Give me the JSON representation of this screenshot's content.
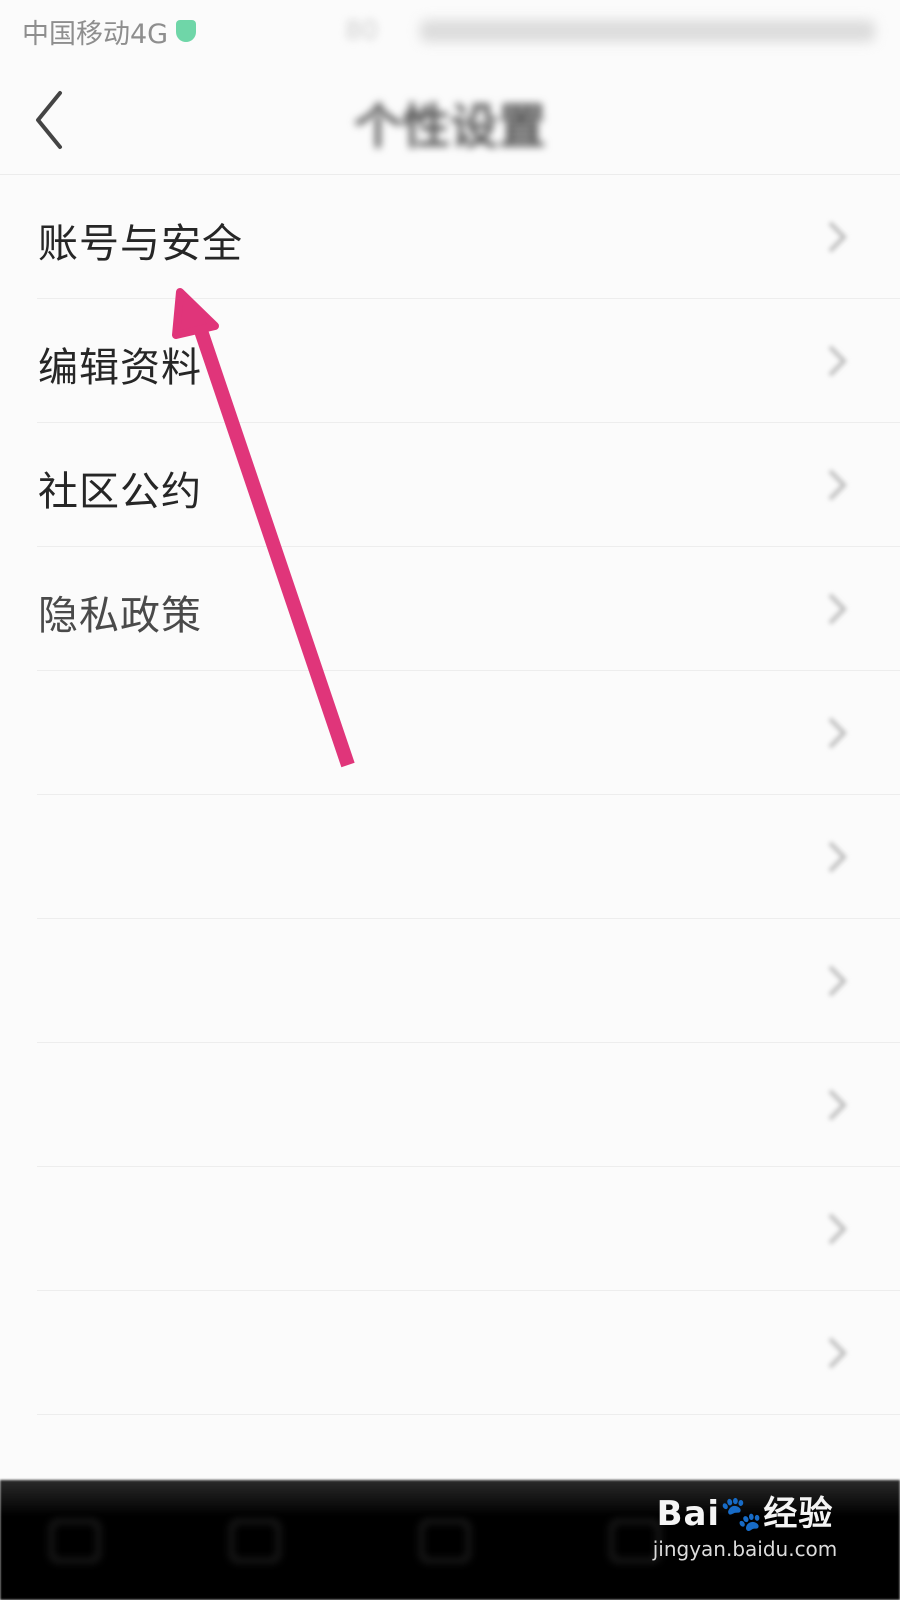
{
  "status_bar": {
    "carrier": "中国移动4G",
    "right_text": "80"
  },
  "header": {
    "title": "个性设置"
  },
  "menu": {
    "items": [
      {
        "label": "账号与安全"
      },
      {
        "label": "编辑资料"
      },
      {
        "label": "社区公约"
      },
      {
        "label": "隐私政策"
      },
      {
        "label": ""
      },
      {
        "label": ""
      },
      {
        "label": ""
      },
      {
        "label": ""
      },
      {
        "label": ""
      },
      {
        "label": ""
      }
    ]
  },
  "watermark": {
    "brand": "Bai🐾经验",
    "url": "jingyan.baidu.com"
  },
  "colors": {
    "annotation_arrow": "#e0357a",
    "background": "#fbfbfb"
  }
}
